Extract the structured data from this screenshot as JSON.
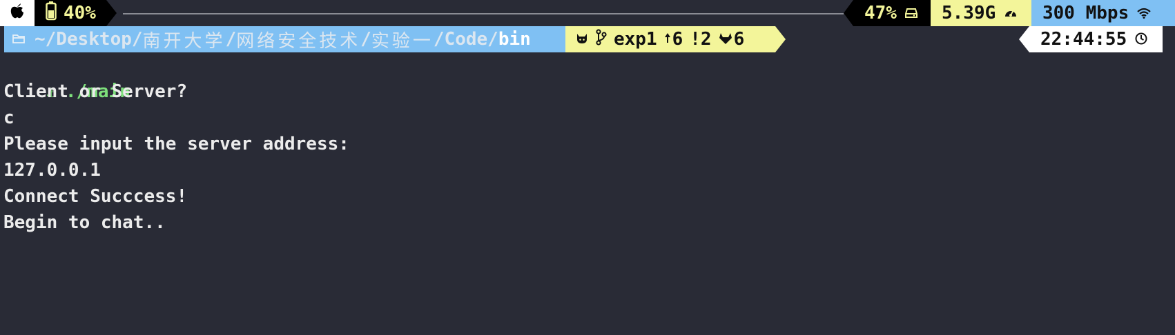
{
  "status_bar": {
    "battery": "40%",
    "disk": "47%",
    "memory": "5.39G",
    "network": "300 Mbps",
    "icons": {
      "apple": "apple-icon",
      "battery": "battery-icon",
      "disk": "hard-drive-icon",
      "memory": "speedometer-icon",
      "network": "wifi-icon"
    }
  },
  "prompt": {
    "path_prefix": "~/Desktop/",
    "path_cjk1": "南开大学",
    "sep1": "/",
    "path_cjk2": "网络安全技术",
    "sep2": "/",
    "path_cjk3": "实验一",
    "path_suffix": "/Code/",
    "path_last": "bin",
    "git_branch": "exp1",
    "git_ahead": "6",
    "git_modified": "!2",
    "git_stash": "6",
    "time": "22:44:55",
    "icons": {
      "folder": "folder-icon",
      "github": "github-cat-icon",
      "branch": "git-branch-icon",
      "ahead": "arrow-up-icon",
      "stash": "gitlab-fox-icon",
      "clock": "clock-icon"
    }
  },
  "terminal": {
    "command": "./main",
    "lines": [
      "Client or Server?",
      "c",
      "Please input the server address:",
      "127.0.0.1",
      "Connect Succcess!",
      "Begin to chat.."
    ]
  },
  "colors": {
    "background": "#292b36",
    "blue": "#7fc0f3",
    "yellow": "#f3f59a",
    "green": "#7ee07c"
  }
}
